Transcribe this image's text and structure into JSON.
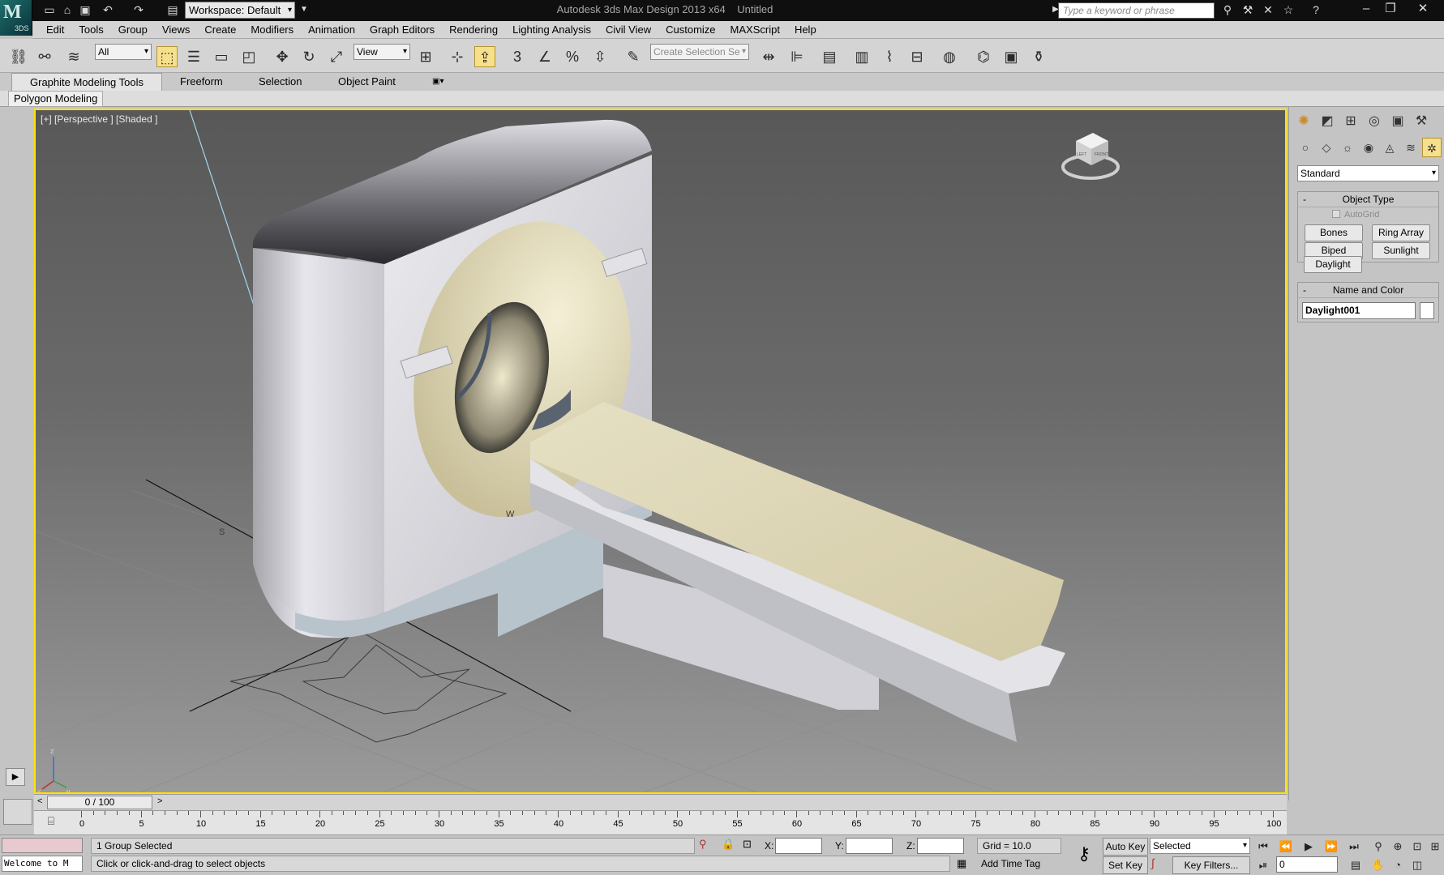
{
  "window": {
    "title": "Autodesk 3ds Max Design 2013 x64",
    "document": "Untitled",
    "logo_text": "3DS"
  },
  "quick_access": {
    "workspace": "Workspace: Default"
  },
  "search": {
    "placeholder": "Type a keyword or phrase"
  },
  "menu": [
    "Edit",
    "Tools",
    "Group",
    "Views",
    "Create",
    "Modifiers",
    "Animation",
    "Graph Editors",
    "Rendering",
    "Lighting Analysis",
    "Civil View",
    "Customize",
    "MAXScript",
    "Help"
  ],
  "toolbar": {
    "selection_filter": "All",
    "ref_coord": "View",
    "named_selection": "Create Selection Se",
    "snap_label": "3"
  },
  "ribbon": {
    "tabs": [
      "Graphite Modeling Tools",
      "Freeform",
      "Selection",
      "Object Paint"
    ],
    "panel": "Polygon Modeling"
  },
  "viewport": {
    "label": "[+] [Perspective ] [Shaded ]",
    "viewcube": {
      "left": "LEFT",
      "front": "FRONT"
    },
    "compass": {
      "s": "S",
      "w": "W"
    },
    "axis": {
      "x": "x",
      "y": "y",
      "z": "z"
    }
  },
  "command_panel": {
    "category": "Standard",
    "object_type": {
      "title": "Object Type",
      "autogrid": "AutoGrid",
      "buttons": [
        "Bones",
        "Ring Array",
        "Biped",
        "Sunlight",
        "Daylight"
      ]
    },
    "name_color": {
      "title": "Name and Color",
      "name": "Daylight001"
    }
  },
  "timeline": {
    "frame": "0 / 100",
    "ticks": [
      "0",
      "5",
      "10",
      "15",
      "20",
      "25",
      "30",
      "35",
      "40",
      "45",
      "50",
      "55",
      "60",
      "65",
      "70",
      "75",
      "80",
      "85",
      "90",
      "95",
      "100"
    ]
  },
  "status": {
    "selection": "1 Group Selected",
    "prompt": "Click or click-and-drag to select objects",
    "listener": "Welcome to M",
    "x_label": "X:",
    "y_label": "Y:",
    "z_label": "Z:",
    "grid": "Grid = 10.0",
    "add_time_tag": "Add Time Tag",
    "auto_key": "Auto Key",
    "set_key": "Set Key",
    "key_mode": "Selected",
    "key_filters": "Key Filters...",
    "current_frame": "0"
  },
  "colors": {
    "viewport_border": "#ffe500",
    "active_tool": "#f7e08c",
    "ct_body": "#d4d4dc",
    "bed": "#dcd6b8"
  }
}
